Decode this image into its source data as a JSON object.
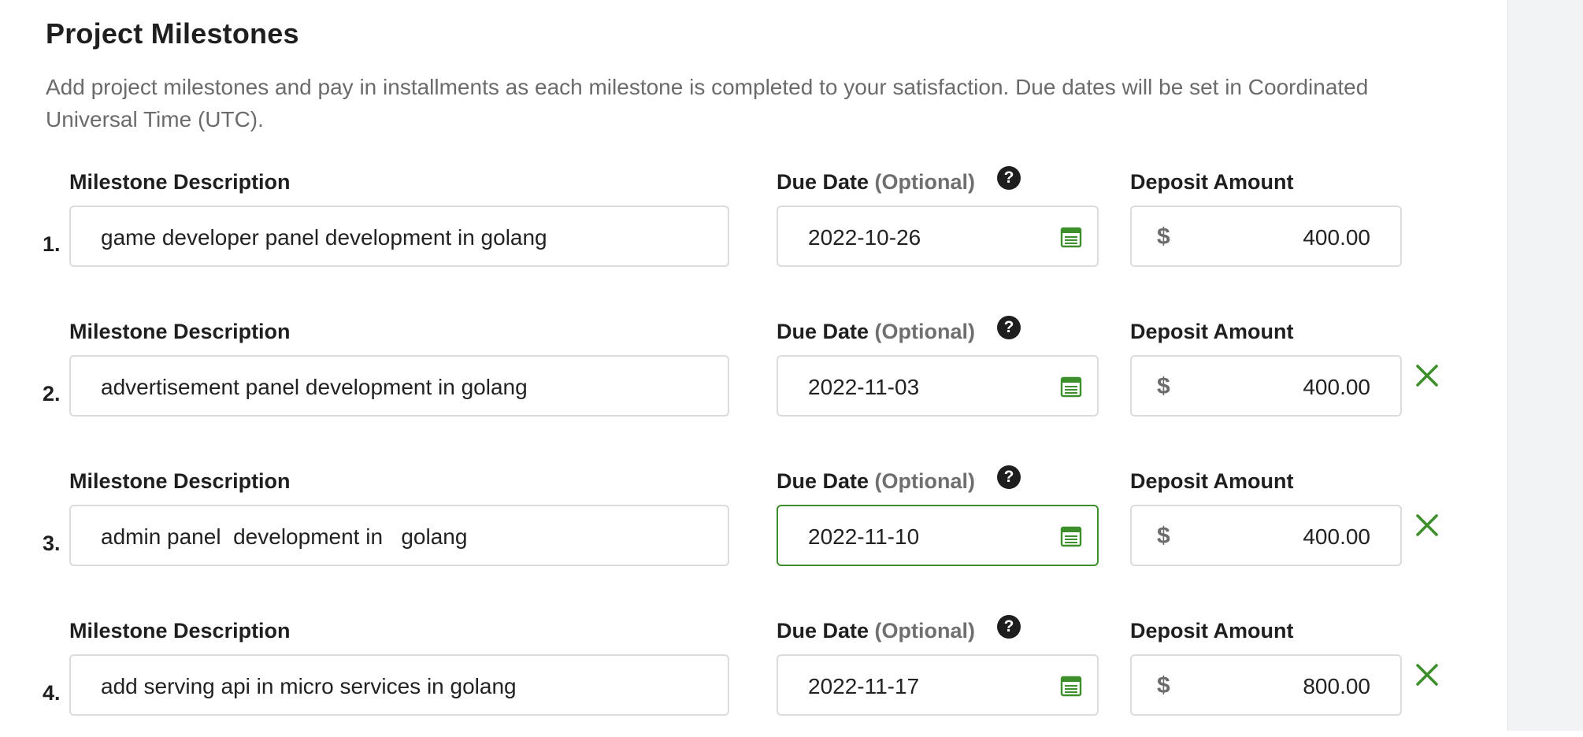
{
  "section": {
    "title": "Project Milestones",
    "description": "Add project milestones and pay in installments as each milestone is completed to your satisfaction. Due dates will be set in Coordinated Universal Time (UTC)."
  },
  "labels": {
    "description": "Milestone Description",
    "due_date": "Due Date",
    "optional": "(Optional)",
    "deposit": "Deposit Amount",
    "currency": "$",
    "help_glyph": "?"
  },
  "milestones": [
    {
      "number": "1.",
      "description": "game developer panel development in golang",
      "due_date": "2022-10-26",
      "amount": "400.00"
    },
    {
      "number": "2.",
      "description": "advertisement panel development in golang",
      "due_date": "2022-11-03",
      "amount": "400.00"
    },
    {
      "number": "3.",
      "description": "admin panel  development in   golang",
      "due_date": "2022-11-10",
      "amount": "400.00"
    },
    {
      "number": "4.",
      "description": "add serving api in micro services in golang",
      "due_date": "2022-11-17",
      "amount": "800.00"
    }
  ],
  "icons": {
    "help": "question-circle-icon",
    "calendar": "calendar-icon",
    "remove": "close-icon"
  },
  "colors": {
    "accent_green": "#3d8f2c",
    "muted_text": "#6b6b6b",
    "border": "#dcdcdc"
  }
}
